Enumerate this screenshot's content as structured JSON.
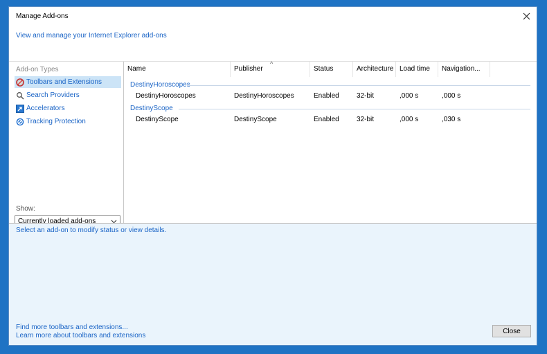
{
  "window": {
    "title": "Manage Add-ons",
    "subtitle": "View and manage your Internet Explorer add-ons"
  },
  "left": {
    "addon_types_label": "Add-on Types",
    "types": [
      {
        "label": "Toolbars and Extensions",
        "icon": "toolbar-gear-icon",
        "selected": true
      },
      {
        "label": "Search Providers",
        "icon": "search-icon",
        "selected": false
      },
      {
        "label": "Accelerators",
        "icon": "accelerator-icon",
        "selected": false
      },
      {
        "label": "Tracking Protection",
        "icon": "block-icon",
        "selected": false
      }
    ],
    "show_label": "Show:",
    "show_value": "Currently loaded add-ons"
  },
  "table": {
    "columns": [
      "Name",
      "Publisher",
      "Status",
      "Architecture",
      "Load time",
      "Navigation..."
    ],
    "groups": [
      {
        "name": "DestinyHoroscopes",
        "rows": [
          [
            "DestinyHoroscopes",
            "DestinyHoroscopes",
            "Enabled",
            "32-bit",
            ",000 s",
            ",000 s"
          ]
        ]
      },
      {
        "name": "DestinyScope",
        "rows": [
          [
            "DestinyScope",
            "DestinyScope",
            "Enabled",
            "32-bit",
            ",000 s",
            ",030 s"
          ]
        ]
      }
    ]
  },
  "details": {
    "hint": "Select an add-on to modify status or view details."
  },
  "footer": {
    "link_find": "Find more toolbars and extensions...",
    "link_learn": "Learn more about toolbars and extensions",
    "close_label": "Close"
  },
  "colors": {
    "link": "#1a64c6",
    "details_bg": "#eaf4fc",
    "selection": "#cce4f7",
    "desktop": "#1f73c4"
  }
}
